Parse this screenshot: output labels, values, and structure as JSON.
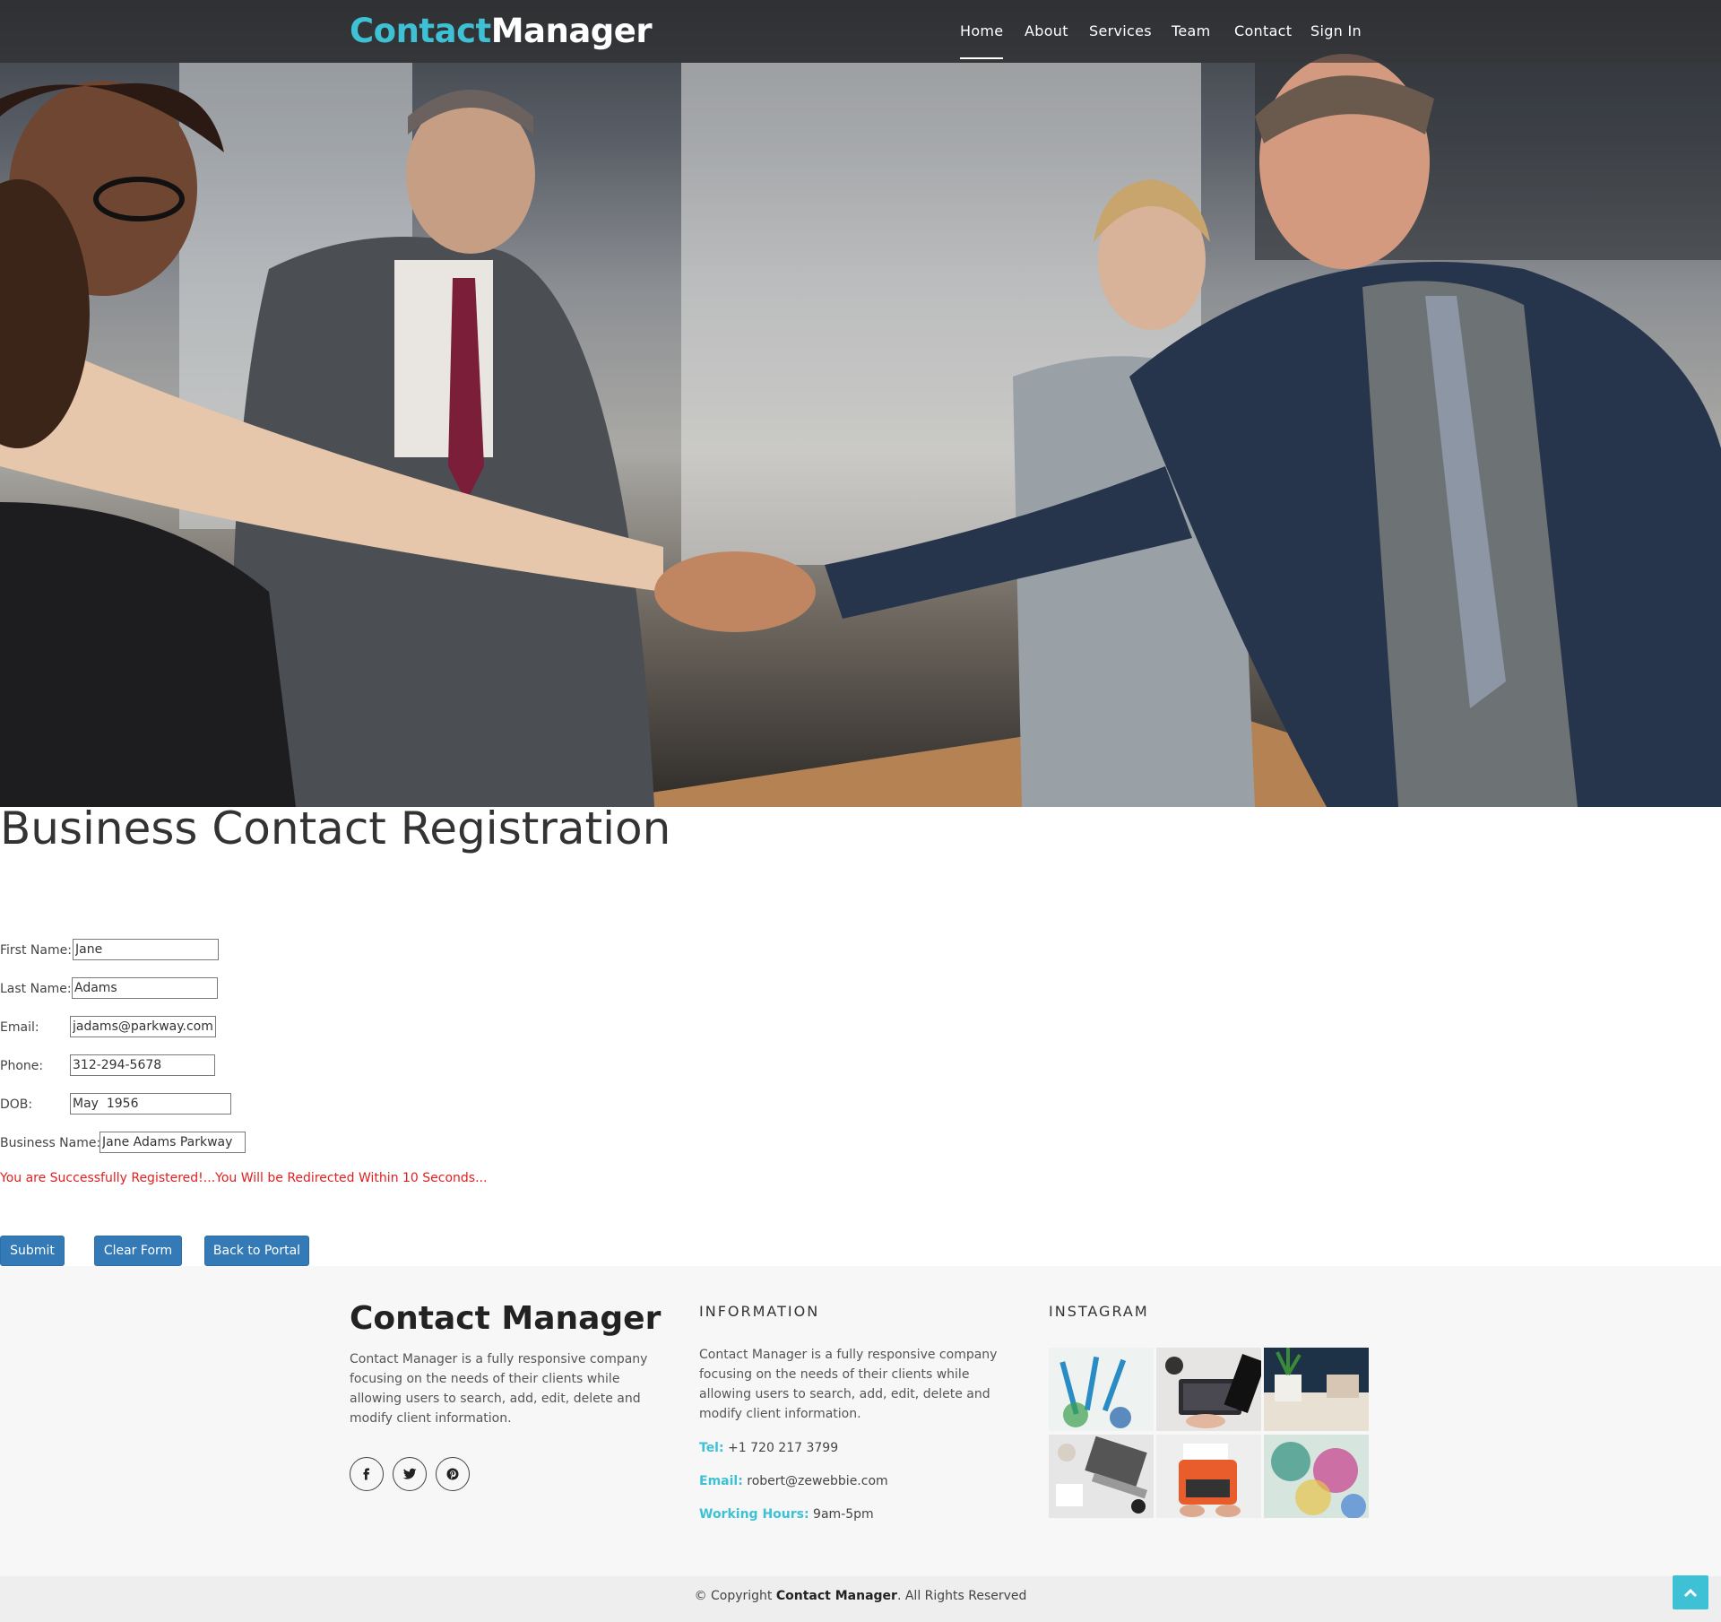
{
  "brand": {
    "part1": "Contact",
    "part2": "Manager",
    "accent_color": "#3ec1d5"
  },
  "nav": {
    "items": [
      {
        "label": "Home",
        "active": true
      },
      {
        "label": "About"
      },
      {
        "label": "Services"
      },
      {
        "label": "Team"
      },
      {
        "label": "Contact"
      },
      {
        "label": "Sign In"
      }
    ]
  },
  "hero": {
    "image": "business-handshake-photo"
  },
  "form": {
    "title": "Business Contact Registration",
    "fields": [
      {
        "label": "First Name:",
        "value": "Jane"
      },
      {
        "label": "Last Name:",
        "value": "Adams"
      },
      {
        "label": "Email:",
        "value": "jadams@parkway.com"
      },
      {
        "label": "Phone:",
        "value": "312-294-5678"
      },
      {
        "label": "DOB:",
        "value": "May  1956"
      },
      {
        "label": "Business Name:",
        "value": "Jane Adams Parkway"
      }
    ],
    "success_message": "You are Successfully Registered!...You Will be Redirected Within 10 Seconds...",
    "buttons": {
      "submit": "Submit",
      "clear": "Clear Form",
      "back": "Back to Portal"
    },
    "button_color": "#337ab7",
    "message_color": "#e02020"
  },
  "footer": {
    "brand": "Contact Manager",
    "about_text": "Contact Manager is a fully responsive company focusing on the needs of their clients while allowing users to search, add, edit, delete and modify client information.",
    "social_icons": [
      "facebook-icon",
      "twitter-icon",
      "pinterest-icon"
    ],
    "information": {
      "heading": "INFORMATION",
      "text": "Contact Manager is a fully responsive company focusing on the needs of their clients while allowing users to search, add, edit, delete and modify client information.",
      "tel_label": "Tel:",
      "tel": "+1 720 217 3799",
      "email_label": "Email:",
      "email": "robert@zewebbie.com",
      "hours_label": "Working Hours:",
      "hours": "9am-5pm"
    },
    "instagram": {
      "heading": "INSTAGRAM",
      "images": [
        "art-supplies-photo",
        "laptop-desk-photo",
        "plant-desk-photo",
        "workspace-laptop-photo",
        "typewriter-photo",
        "abstract-paint-photo"
      ]
    },
    "copyright_prefix": "© Copyright",
    "copyright_brand": "Contact Manager",
    "copyright_suffix": ". All Rights Reserved"
  },
  "back_to_top_icon": "chevron-up-icon"
}
